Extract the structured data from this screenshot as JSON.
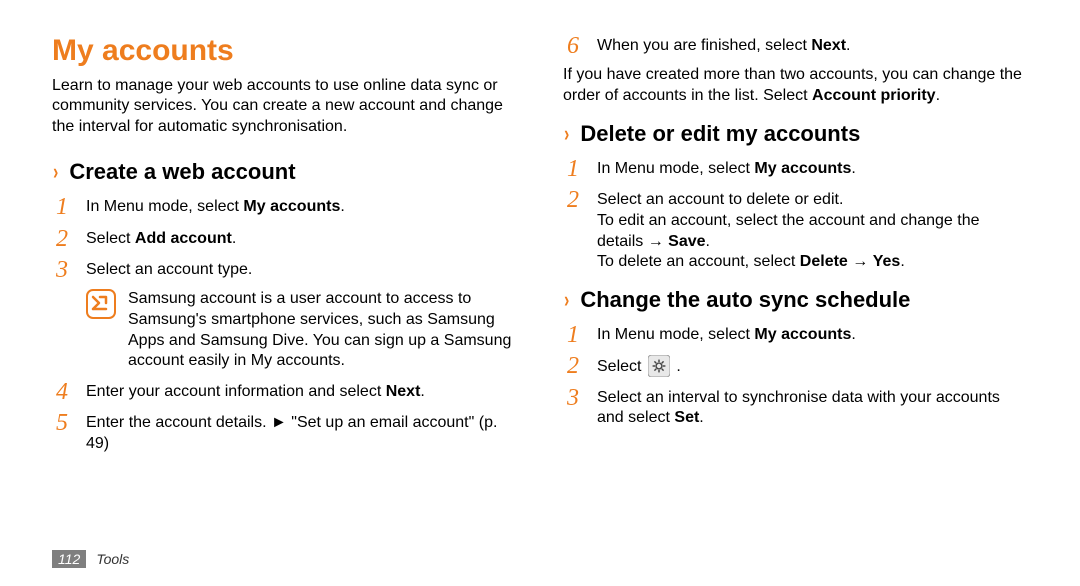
{
  "page_title": "My accounts",
  "intro": "Learn to manage your web accounts to use online data sync or community services. You can create a new account and change the interval for automatic synchronisation.",
  "left": {
    "section1_title": "Create a web account",
    "steps1": [
      {
        "num": "1",
        "html": "In Menu mode, select <b>My accounts</b>."
      },
      {
        "num": "2",
        "html": "Select <b>Add account</b>."
      },
      {
        "num": "3",
        "html": "Select an account type."
      }
    ],
    "note": "Samsung account is a user account to access to Samsung's smartphone services, such as Samsung Apps and Samsung Dive. You can sign up a Samsung account easily in My accounts.",
    "steps1b": [
      {
        "num": "4",
        "html": "Enter your account information and select <b>Next</b>."
      },
      {
        "num": "5",
        "html": "Enter the account details. ► \"Set up an email account\" (p. 49)"
      }
    ]
  },
  "right": {
    "steps_top": [
      {
        "num": "6",
        "html": "When you are finished, select <b>Next</b>."
      }
    ],
    "para_after6": "If you have created more than two accounts, you can change the order of accounts in the list. Select <b>Account priority</b>.",
    "section2_title": "Delete or edit my accounts",
    "steps2": [
      {
        "num": "1",
        "html": "In Menu mode, select <b>My accounts</b>."
      },
      {
        "num": "2",
        "html": "Select an account to delete or edit.<br>To edit an account, select the account and change the details → <b>Save</b>.<br>To delete an account, select <b>Delete</b> → <b>Yes</b>."
      }
    ],
    "section3_title": "Change the auto sync schedule",
    "steps3": [
      {
        "num": "1",
        "html": "In Menu mode, select <b>My accounts</b>."
      },
      {
        "num": "2",
        "html": "Select {{gear}} ."
      },
      {
        "num": "3",
        "html": "Select an interval to synchronise data with your accounts and select <b>Set</b>."
      }
    ]
  },
  "footer": {
    "page_num": "112",
    "section": "Tools"
  },
  "icons": {
    "note": "note-icon",
    "gear": "gear-icon"
  }
}
